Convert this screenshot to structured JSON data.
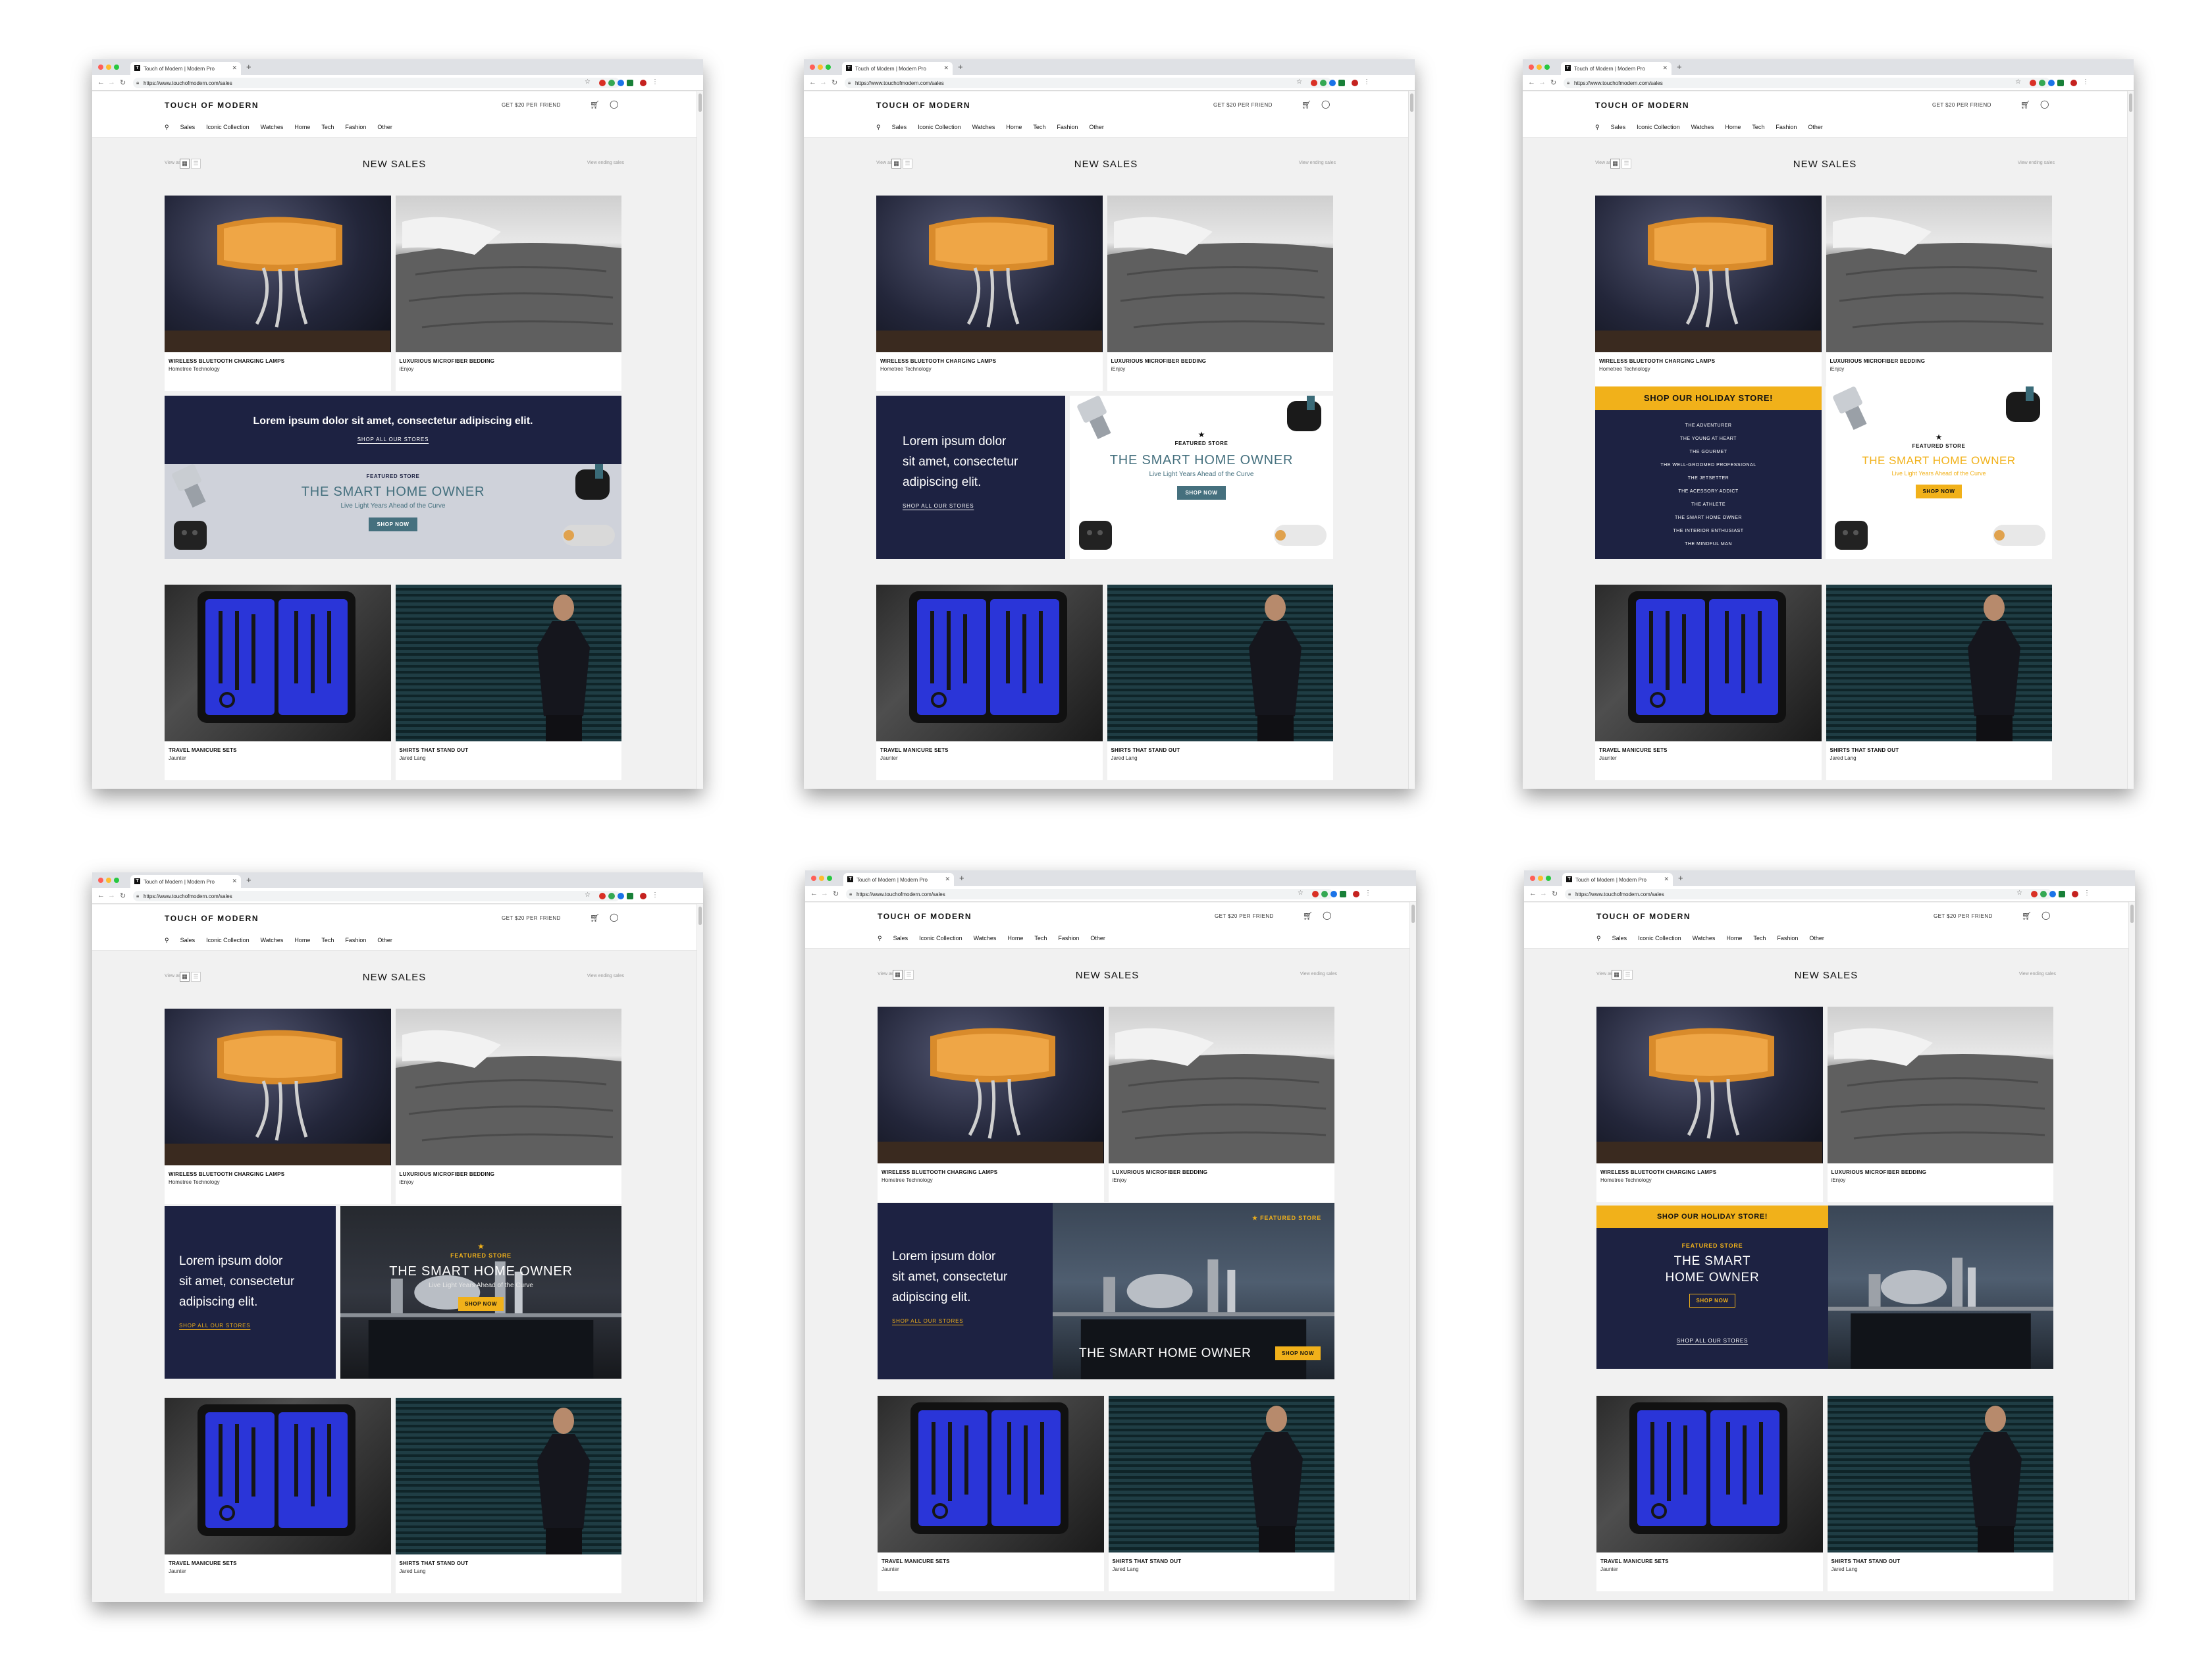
{
  "browser": {
    "tab_title": "Touch of Modern | Modern Pro",
    "favicon_letter": "T",
    "url": "https://www.touchofmodern.com/sales"
  },
  "site": {
    "brand": "TOUCH OF MODERN",
    "promo": "GET $20 PER FRIEND",
    "menu": [
      "Sales",
      "Iconic Collection",
      "Watches",
      "Home",
      "Tech",
      "Fashion",
      "Other"
    ],
    "view_as": "View as",
    "heading": "NEW SALES",
    "view_ending": "View ending sales"
  },
  "products": {
    "top": [
      {
        "title": "WIRELESS BLUETOOTH CHARGING LAMPS",
        "subtitle": "Hometree Technology"
      },
      {
        "title": "LUXURIOUS MICROFIBER BEDDING",
        "subtitle": "iEnjoy"
      }
    ],
    "bottom": [
      {
        "title": "TRAVEL MANICURE SETS",
        "subtitle": "Jaunter"
      },
      {
        "title": "SHIRTS THAT STAND OUT",
        "subtitle": "Jared Lang"
      }
    ]
  },
  "banner": {
    "lorem_line": "Lorem ipsum dolor sit amet, consectetur adipiscing elit.",
    "lorem_split": [
      "Lorem ipsum dolor",
      "sit amet, consectetur",
      "adipiscing elit."
    ],
    "shop_all": "SHOP ALL OUR STORES",
    "featured": "FEATURED STORE",
    "store_name": "THE SMART HOME OWNER",
    "store_name_split": [
      "THE SMART",
      "HOME OWNER"
    ],
    "tagline": "Live Light Years Ahead of the Curve",
    "shop_now": "SHOP NOW",
    "holiday": "SHOP OUR HOLIDAY STORE!",
    "holiday_list": [
      "THE ADVENTURER",
      "THE YOUNG AT HEART",
      "THE GOURMET",
      "THE WELL-GROOMED PROFESSIONAL",
      "THE JETSETTER",
      "THE ACESSORY ADDICT",
      "THE ATHLETE",
      "THE SMART HOME OWNER",
      "THE INTERIOR ENTHUSIAST",
      "THE MINDFUL MAN"
    ]
  },
  "colors": {
    "navy": "#1d2242",
    "gold": "#f1b11a",
    "teal": "#45707e",
    "page_bg": "#f1f1f1"
  }
}
